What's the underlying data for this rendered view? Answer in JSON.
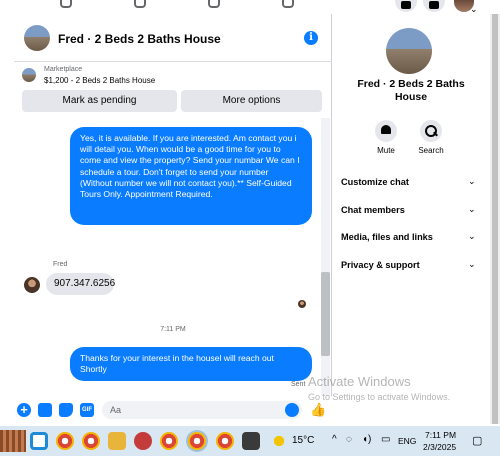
{
  "chat": {
    "title": "Fred · 2 Beds 2 Baths House",
    "marketplace": {
      "label": "Marketplace",
      "listing": "$1,200 - 2 Beds 2 Baths House",
      "buttons": {
        "pending": "Mark as pending",
        "more": "More options"
      }
    },
    "messages": [
      {
        "from": "me",
        "text": "Yes, it is available. If you are interested.  Am contact you i will detail you.  When would be a good time for you to come and view the property? Send your numbar We can I schedule a tour.  Don't forget to send your number (Without number we will not contact you).** Self-Guided Tours Only. Appointment Required."
      },
      {
        "from": "Fred",
        "sender_name": "Fred",
        "text": "907.347.6256"
      },
      {
        "type": "timestamp",
        "text": "7:11 PM"
      },
      {
        "from": "me",
        "text": "Thanks for your interest in the housel will reach out Shortly"
      }
    ],
    "sent_status": "Sent",
    "composer": {
      "placeholder": "Aa",
      "gif_label": "GIF"
    }
  },
  "info_panel": {
    "name": "Fred · 2 Beds 2 Baths House",
    "actions": [
      {
        "label": "Mute",
        "icon": "bell-icon"
      },
      {
        "label": "Search",
        "icon": "search-icon"
      }
    ],
    "sections": [
      "Customize chat",
      "Chat members",
      "Media, files and links",
      "Privacy & support"
    ]
  },
  "watermark": {
    "title": "Activate Windows",
    "subtitle": "Go to Settings to activate Windows."
  },
  "taskbar": {
    "weather": "15°C",
    "language": "ENG",
    "time": "7:11 PM",
    "date": "2/3/2025"
  },
  "colors": {
    "accent": "#0a7cff",
    "bubble_in": "#e4e6eb",
    "taskbar": "#d9e7f3"
  }
}
